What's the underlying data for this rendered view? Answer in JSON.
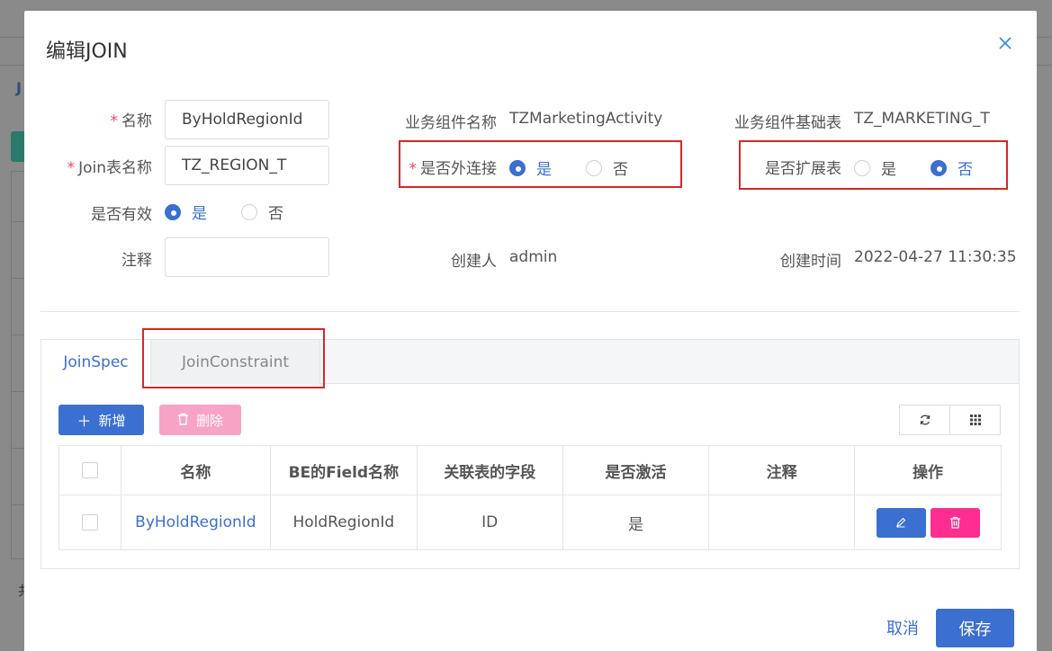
{
  "background": {
    "page_initial": "J",
    "footer_initial": "共"
  },
  "modal": {
    "title": "编辑JOIN",
    "close_icon": "close-icon",
    "form": {
      "name_label": "名称",
      "name_value": "ByHoldRegionId",
      "join_table_label": "Join表名称",
      "join_table_value": "TZ_REGION_T",
      "is_valid_label": "是否有效",
      "is_valid_yes": "是",
      "is_valid_no": "否",
      "comment_label": "注释",
      "comment_value": "",
      "component_name_label": "业务组件名称",
      "component_name_value": "TZMarketingActivity",
      "outer_join_label": "是否外连接",
      "outer_join_yes": "是",
      "outer_join_no": "否",
      "creator_label": "创建人",
      "creator_value": "admin",
      "base_table_label": "业务组件基础表",
      "base_table_value": "TZ_MARKETING_T",
      "extension_label": "是否扩展表",
      "extension_yes": "是",
      "extension_no": "否",
      "created_time_label": "创建时间",
      "created_time_value": "2022-04-27 11:30:35"
    },
    "selected": {
      "is_valid": "是",
      "outer_join": "是",
      "extension": "否"
    },
    "tabs": [
      {
        "label": "JoinSpec",
        "active": true
      },
      {
        "label": "JoinConstraint",
        "active": false
      }
    ],
    "toolbar": {
      "add_label": "新增",
      "delete_label": "删除",
      "refresh_icon": "refresh-icon",
      "columns_icon": "grid-icon"
    },
    "table": {
      "headers": [
        "名称",
        "BE的Field名称",
        "关联表的字段",
        "是否激活",
        "注释",
        "操作"
      ],
      "rows": [
        {
          "name": "ByHoldRegionId",
          "field": "HoldRegionId",
          "rel_field": "ID",
          "active": "是",
          "comment": ""
        }
      ]
    },
    "footer": {
      "cancel_label": "取消",
      "save_label": "保存"
    }
  },
  "colors": {
    "primary": "#3b6fd0",
    "danger": "#ff2d8f",
    "highlight": "#d62828"
  }
}
